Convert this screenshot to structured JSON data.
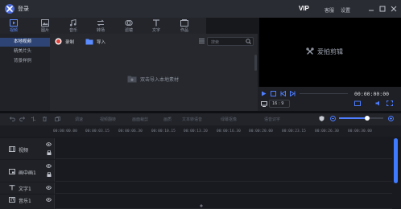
{
  "titlebar": {
    "login": "登录",
    "vip": "VIP",
    "feedback": "客服",
    "settings": "设置"
  },
  "tabs": [
    {
      "label": "视频",
      "icon": "video-icon",
      "active": true
    },
    {
      "label": "图片",
      "icon": "image-icon",
      "active": false
    },
    {
      "label": "音乐",
      "icon": "music-icon",
      "active": false
    },
    {
      "label": "转场",
      "icon": "transition-icon",
      "active": false
    },
    {
      "label": "滤镜",
      "icon": "filter-icon",
      "active": false
    },
    {
      "label": "文字",
      "icon": "text-icon",
      "active": false
    },
    {
      "label": "作品",
      "icon": "works-icon",
      "active": false
    }
  ],
  "sidebar": {
    "items": [
      {
        "label": "本地视频",
        "active": true
      },
      {
        "label": "精美片头",
        "active": false
      },
      {
        "label": "背景样例",
        "active": false
      }
    ]
  },
  "media": {
    "record_label": "录制",
    "import_label": "导入",
    "search_placeholder": "搜索",
    "empty_hint": "双击导入本地素材"
  },
  "preview": {
    "brand": "爱拍剪辑",
    "timecode": "00:00:00:00",
    "ratio": "16 : 9"
  },
  "toolbar": {
    "tools": [
      "调速",
      "视频翻转",
      "画面裁剪",
      "画质",
      "文本转语音",
      "绿幕抠像",
      "语音识字"
    ]
  },
  "ruler": {
    "ticks": [
      "00:00:00.00",
      "00:00:03.15",
      "00:00:06.30",
      "00:00:10.15",
      "00:00:13.20",
      "00:00:16.30",
      "00:00:20.00",
      "00:00:23.15",
      "00:00:26.30",
      "00:00:30.00"
    ]
  },
  "tracks": [
    {
      "label": "视频",
      "icon": "film-icon"
    },
    {
      "label": "画中画1",
      "icon": "picture-in-picture-icon"
    },
    {
      "label": "文字1",
      "icon": "text-track-icon"
    },
    {
      "label": "音乐1",
      "icon": "music-track-icon"
    }
  ],
  "colors": {
    "accent": "#4e7dff",
    "nav_active": "#2d4474",
    "record": "#e0443c"
  }
}
